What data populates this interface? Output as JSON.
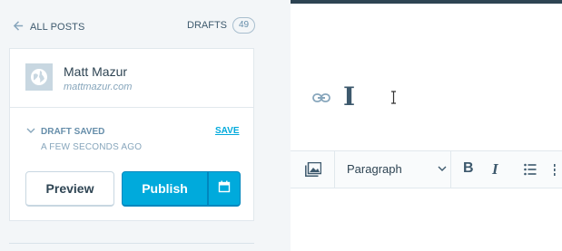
{
  "nav": {
    "back_label": "ALL POSTS",
    "drafts_label": "DRAFTS",
    "drafts_count": "49"
  },
  "site": {
    "name": "Matt Mazur",
    "url": "mattmazur.com"
  },
  "status": {
    "draft_label": "DRAFT SAVED",
    "save_label": "SAVE",
    "time_label": "A FEW SECONDS AGO"
  },
  "actions": {
    "preview_label": "Preview",
    "publish_label": "Publish"
  },
  "editor": {
    "title_caret": "I",
    "format_select": "Paragraph",
    "bold_label": "B",
    "italic_label": "I"
  },
  "colors": {
    "accent": "#00aadc",
    "sidebar_bg": "#f3f6f8",
    "text_dark": "#2e4453"
  },
  "icons": [
    "arrow-left-icon",
    "globe-icon",
    "chevron-down-icon",
    "calendar-icon",
    "link-icon",
    "text-cursor-icon",
    "media-icon",
    "bullet-list-icon"
  ]
}
